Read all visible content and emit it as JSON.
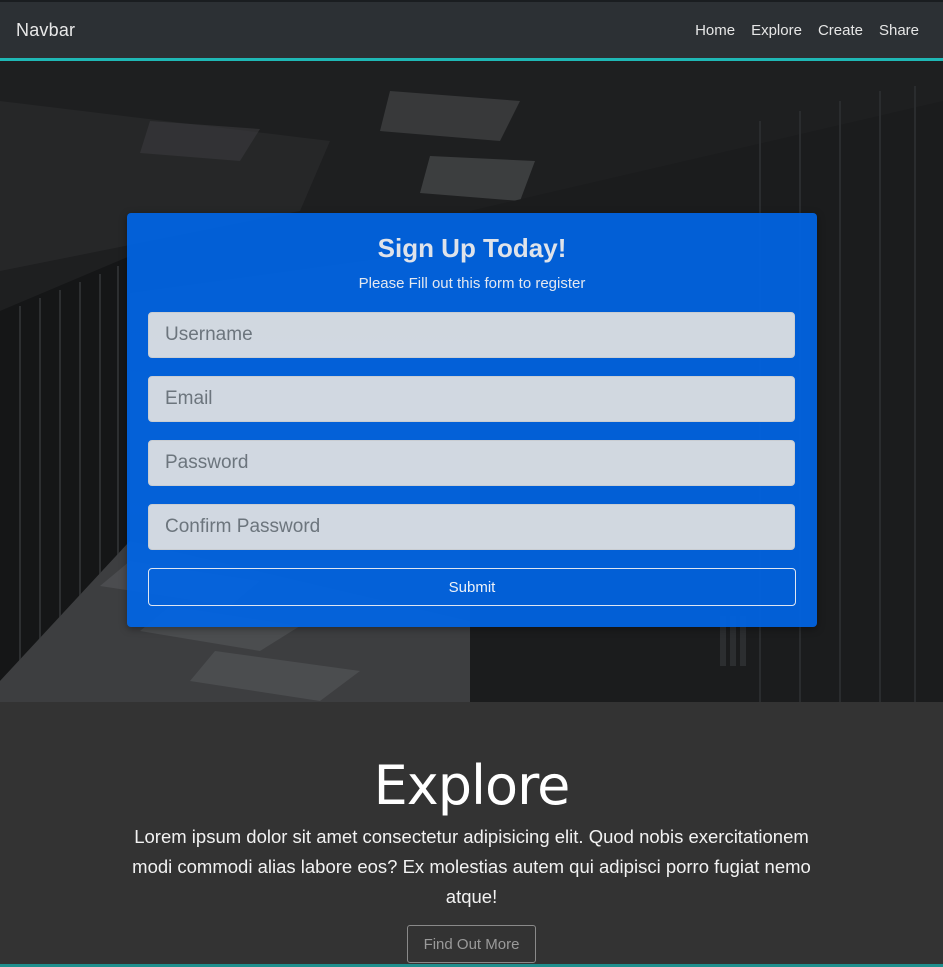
{
  "navbar": {
    "brand": "Navbar",
    "links": [
      "Home",
      "Explore",
      "Create",
      "Share"
    ],
    "accent_color": "#1fb8b5"
  },
  "signup": {
    "title": "Sign Up Today!",
    "subtitle": "Please Fill out this form to register",
    "fields": {
      "username_placeholder": "Username",
      "email_placeholder": "Email",
      "password_placeholder": "Password",
      "confirm_placeholder": "Confirm Password"
    },
    "submit_label": "Submit",
    "card_color": "#0065e6"
  },
  "explore": {
    "title": "Explore",
    "body": "Lorem ipsum dolor sit amet consectetur adipisicing elit. Quod nobis exercitationem modi commodi alias labore eos? Ex molestias autem qui adipisci porro fugiat nemo atque!",
    "button_label": "Find Out More"
  }
}
